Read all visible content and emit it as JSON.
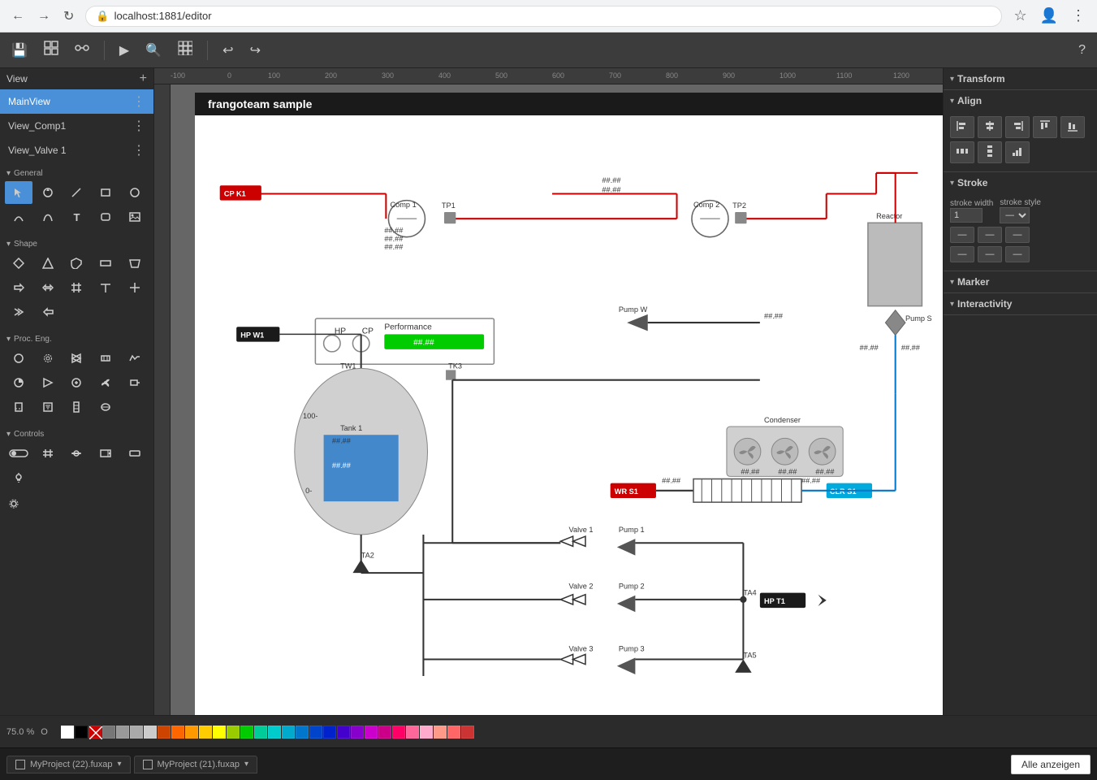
{
  "browser": {
    "url": "localhost:1881/editor",
    "back_btn": "←",
    "forward_btn": "→",
    "reload_btn": "↻"
  },
  "toolbar": {
    "save_label": "💾",
    "shapes_label": "⊞",
    "connect_label": "⚙",
    "play_label": "▶",
    "zoom_label": "🔍",
    "grid_label": "⊞",
    "undo_label": "↩",
    "redo_label": "↪",
    "help_label": "?"
  },
  "sidebar": {
    "view_label": "View",
    "add_label": "+",
    "views": [
      {
        "label": "MainView",
        "active": true
      },
      {
        "label": "View_Comp1",
        "active": false
      },
      {
        "label": "View_Valve 1",
        "active": false
      }
    ],
    "sections": [
      {
        "title": "General",
        "tools": [
          "cursor",
          "loop",
          "line",
          "rect",
          "circle",
          "arc",
          "bezier",
          "text",
          "rect-r",
          "image",
          "poly",
          "arrow-r",
          "label",
          "parallelogram",
          "pentagon",
          "hexagon",
          "octagon",
          "chevron",
          "arrow",
          "double-arrow",
          "pin"
        ]
      },
      {
        "title": "Shape",
        "tools": [
          "diamond",
          "triangle",
          "shield",
          "rect-wide",
          "trapezoid",
          "arc2",
          "circle2",
          "chevron2",
          "parallelogram2",
          "arrow-left",
          "hash",
          "t-shape",
          "cross",
          "pentagon2"
        ]
      },
      {
        "title": "Proc. Eng.",
        "tools": [
          "circ-proc",
          "gear",
          "valve",
          "heat-ex",
          "signal",
          "pump-cent",
          "pump-pos",
          "comp",
          "fan",
          "motor",
          "tank",
          "filter",
          "column",
          "separator"
        ]
      },
      {
        "title": "Controls",
        "tools": [
          "switch",
          "hash-ctrl",
          "slider-h",
          "dropdown",
          "btn-ctrl",
          "light"
        ]
      }
    ]
  },
  "canvas": {
    "title": "frangoteam sample",
    "zoom": "75.0 %",
    "zoom_suffix": "O"
  },
  "diagram": {
    "nodes": [
      {
        "id": "cp_k1",
        "label": "CP K1",
        "type": "label-red"
      },
      {
        "id": "comp1",
        "label": "Comp 1",
        "type": "compressor"
      },
      {
        "id": "tp1",
        "label": "TP1",
        "type": "valve"
      },
      {
        "id": "comp2",
        "label": "Comp 2",
        "type": "compressor"
      },
      {
        "id": "tp2",
        "label": "TP2",
        "type": "valve"
      },
      {
        "id": "reactor",
        "label": "Reactor",
        "type": "reactor"
      },
      {
        "id": "hp_panel",
        "label": "HP",
        "type": "panel"
      },
      {
        "id": "cp_panel",
        "label": "CP",
        "type": "panel"
      },
      {
        "id": "perf_panel",
        "label": "Performance",
        "type": "panel"
      },
      {
        "id": "hp_w1",
        "label": "HP W1",
        "type": "label-black"
      },
      {
        "id": "pump_w",
        "label": "Pump W",
        "type": "pump"
      },
      {
        "id": "pump_s",
        "label": "Pump S",
        "type": "pump"
      },
      {
        "id": "tank1",
        "label": "Tank 1",
        "type": "tank"
      },
      {
        "id": "tw1",
        "label": "TW1",
        "type": "valve-small"
      },
      {
        "id": "tk3",
        "label": "TK3",
        "type": "valve-small"
      },
      {
        "id": "condenser",
        "label": "Condenser",
        "type": "condenser"
      },
      {
        "id": "wr_s1",
        "label": "WR S1",
        "type": "label-red"
      },
      {
        "id": "clr_s1",
        "label": "CLR S1",
        "type": "label-cyan"
      },
      {
        "id": "hp_t1",
        "label": "HP T1",
        "type": "label-black-arrow"
      },
      {
        "id": "valve1",
        "label": "Valve 1",
        "type": "valve-node"
      },
      {
        "id": "pump1",
        "label": "Pump 1",
        "type": "pump-small"
      },
      {
        "id": "valve2",
        "label": "Valve 2",
        "type": "valve-node"
      },
      {
        "id": "pump2",
        "label": "Pump 2",
        "type": "pump-small"
      },
      {
        "id": "valve3",
        "label": "Valve 3",
        "type": "valve-node"
      },
      {
        "id": "pump3",
        "label": "Pump 3",
        "type": "pump-small"
      },
      {
        "id": "ta2",
        "label": "TA2",
        "type": "junction"
      },
      {
        "id": "ta4",
        "label": "TA4",
        "type": "junction"
      },
      {
        "id": "ta5",
        "label": "TA5",
        "type": "junction"
      }
    ],
    "values": {
      "placeholder": "##.##"
    }
  },
  "right_panel": {
    "sections": [
      {
        "id": "transform",
        "label": "Transform",
        "open": true
      },
      {
        "id": "align",
        "label": "Align",
        "open": true
      },
      {
        "id": "stroke",
        "label": "Stroke",
        "open": true
      },
      {
        "id": "marker",
        "label": "Marker",
        "open": true
      },
      {
        "id": "interactivity",
        "label": "Interactivity",
        "open": true
      }
    ],
    "stroke": {
      "width_label": "stroke width",
      "style_label": "stroke style",
      "width_value": "1"
    },
    "align_buttons": [
      "⬜",
      "⬛",
      "▣",
      "⬜",
      "⬜",
      "⬜",
      "⬜",
      "⬜",
      "⬜",
      "⬜"
    ],
    "stroke_buttons": [
      "—",
      "—",
      "—",
      "—",
      "—",
      "—"
    ]
  },
  "bottom_bar": {
    "zoom_text": "75.0 %",
    "zoom_suffix": "O",
    "swatches": [
      "#ffffff",
      "#000000",
      "#cc0000",
      "#888888",
      "#aaaaaa",
      "#cccccc",
      "#ff6600",
      "#ff9900",
      "#ffcc00",
      "#ffff00",
      "#99cc00",
      "#00cc00",
      "#00cc99",
      "#00cccc",
      "#0099cc",
      "#0066cc",
      "#0033cc",
      "#6600cc",
      "#cc00cc",
      "#cc0066",
      "#ff99cc",
      "#ffcccc",
      "#ff6666",
      "#cc3333"
    ]
  },
  "file_tabs": [
    {
      "label": "MyProject (22).fuxap",
      "active": false
    },
    {
      "label": "MyProject (21).fuxap",
      "active": false
    }
  ],
  "alle_anzeigen": "Alle anzeigen"
}
